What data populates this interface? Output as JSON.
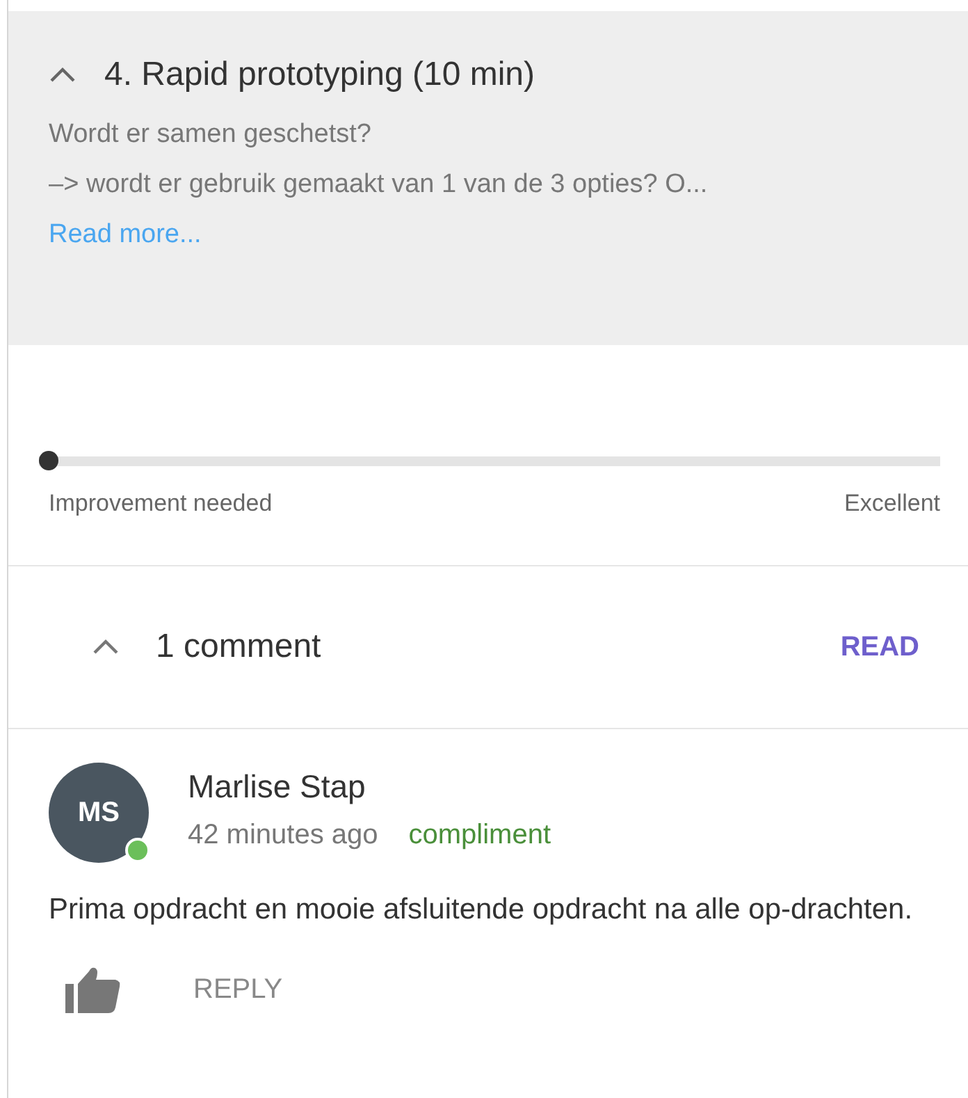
{
  "criterion": {
    "title": "4. Rapid prototyping (10 min)",
    "expanded": true,
    "description_lines": [
      "Wordt er samen geschetst?",
      "–> wordt er gebruik gemaakt van 1 van de 3 opties? O..."
    ],
    "read_more": "Read more..."
  },
  "rating": {
    "level": 0,
    "min_label": "Improvement needed",
    "max_label": "Excellent"
  },
  "comments_header": {
    "expanded": true,
    "count_label": "1 comment",
    "action": "READ"
  },
  "comments": [
    {
      "initials": "MS",
      "online": true,
      "author": "Marlise Stap",
      "time": "42 minutes ago",
      "tag": "compliment",
      "text": "Prima opdracht en mooie afsluitende opdracht na alle op-drachten.",
      "reply": "REPLY"
    }
  ]
}
